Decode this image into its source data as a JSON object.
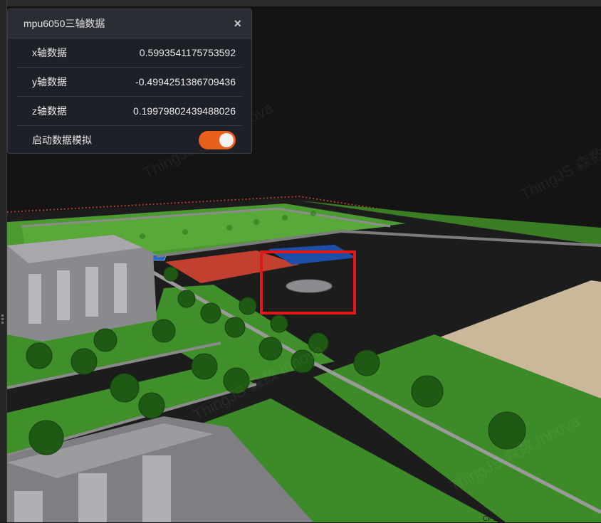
{
  "panel": {
    "title": "mpu6050三轴数据",
    "close_glyph": "×",
    "rows": [
      {
        "label": "x轴数据",
        "value": "0.5993541175753592"
      },
      {
        "label": "y轴数据",
        "value": "-0.4994251386709436"
      },
      {
        "label": "z轴数据",
        "value": "0.19979802439488026"
      }
    ],
    "toggle": {
      "label": "启动数据模拟",
      "enabled": true
    }
  },
  "watermarks": [
    "ThingJS 森数 Innova",
    "ThingJS 森数 Innova",
    "ThingJS 森数 Innova",
    "ThingJS 森数 Innova"
  ],
  "footer": {
    "cpu_text": "CPU"
  },
  "colors": {
    "accent": "#e8601c",
    "highlight": "#e01818",
    "grass": "#3f8f2a",
    "road": "#1c1c1c"
  }
}
